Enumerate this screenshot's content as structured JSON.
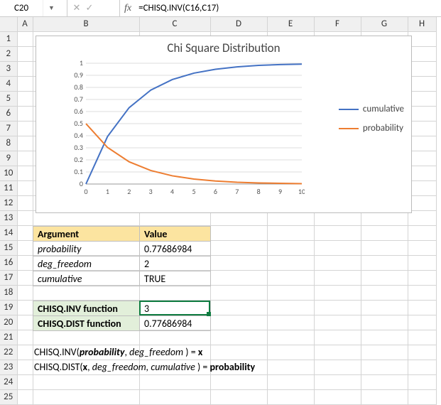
{
  "formula_bar": {
    "cell_ref": "C20",
    "formula": "=CHISQ.INV(C16,C17)",
    "fx_label": "fx"
  },
  "columns": [
    "A",
    "B",
    "C",
    "D",
    "E",
    "F",
    "G",
    "H"
  ],
  "rows": [
    "1",
    "2",
    "3",
    "4",
    "5",
    "6",
    "7",
    "8",
    "9",
    "10",
    "11",
    "12",
    "13",
    "14",
    "15",
    "16",
    "17",
    "18",
    "19",
    "20",
    "21",
    "22",
    "23",
    "24",
    "25"
  ],
  "chart": {
    "title": "Chi Square Distribution",
    "legend": {
      "items": [
        "cumulative",
        "probability"
      ],
      "colors": [
        "#4472C4",
        "#ED7D31"
      ]
    },
    "x_ticks": [
      "0",
      "1",
      "2",
      "3",
      "4",
      "5",
      "6",
      "7",
      "8",
      "9",
      "10"
    ],
    "y_ticks": [
      "0",
      "0.1",
      "0.2",
      "0.3",
      "0.4",
      "0.5",
      "0.6",
      "0.7",
      "0.8",
      "0.9",
      "1"
    ]
  },
  "chart_data": {
    "type": "line",
    "title": "Chi Square Distribution",
    "xlabel": "",
    "ylabel": "",
    "xlim": [
      0,
      10
    ],
    "ylim": [
      0,
      1
    ],
    "x": [
      0,
      1,
      2,
      3,
      4,
      5,
      6,
      7,
      8,
      9,
      10
    ],
    "series": [
      {
        "name": "cumulative",
        "color": "#4472C4",
        "values": [
          0,
          0.393,
          0.632,
          0.777,
          0.865,
          0.918,
          0.95,
          0.97,
          0.982,
          0.989,
          0.993
        ]
      },
      {
        "name": "probability",
        "color": "#ED7D31",
        "values": [
          0.5,
          0.303,
          0.184,
          0.112,
          0.068,
          0.041,
          0.025,
          0.015,
          0.009,
          0.006,
          0.003
        ]
      }
    ]
  },
  "args_table": {
    "headers": [
      "Argument",
      "Value"
    ],
    "rows": [
      {
        "arg": "probability",
        "val": "0.77686984"
      },
      {
        "arg": "deg_freedom",
        "val": "2"
      },
      {
        "arg": "cumulative",
        "val": "TRUE"
      }
    ]
  },
  "func_table": {
    "rows": [
      {
        "label": "CHISQ.INV function",
        "val": "3"
      },
      {
        "label": "CHISQ.DIST function",
        "val": "0.77686984"
      }
    ]
  },
  "captions": {
    "line1_a": "CHISQ.INV(",
    "line1_b": "probability",
    "line1_c": ", ",
    "line1_d": "deg_freedom",
    "line1_e": " ) = ",
    "line1_f": "x",
    "line2_a": "CHISQ.DIST(",
    "line2_b": "x",
    "line2_c": ", ",
    "line2_d": "deg_freedom, cumulative",
    "line2_e": " ) = ",
    "line2_f": "probability"
  },
  "selected_cell": "C20"
}
